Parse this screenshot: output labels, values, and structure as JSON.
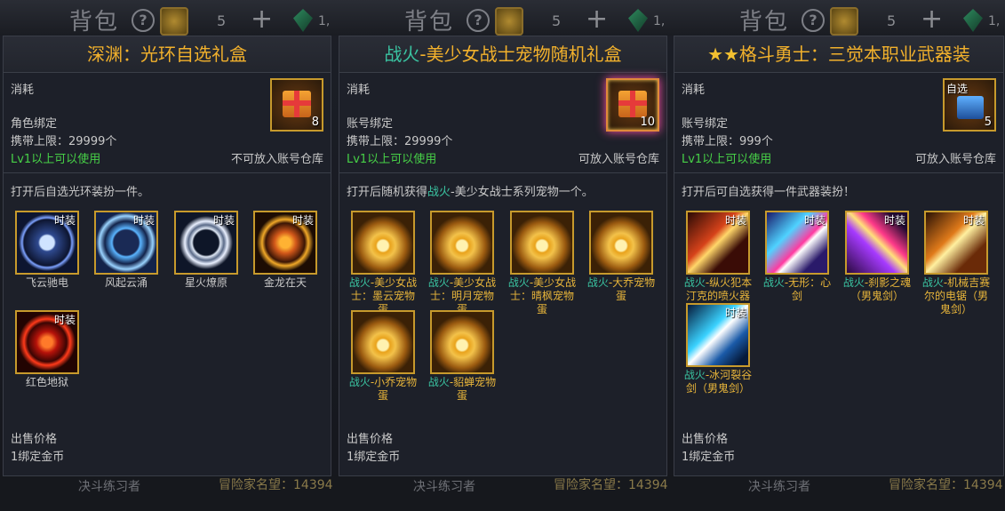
{
  "hud": {
    "title": "背包",
    "help": "?",
    "count": "5",
    "plus": "+",
    "gem_count": "1,",
    "player_name": "决斗练习者",
    "reputation": "冒险家名望：14394"
  },
  "panels": [
    {
      "title": "深渊：光环自选礼盒",
      "consume": "消耗",
      "bind": "角色绑定",
      "limit": "携带上限：29999个",
      "level": "Lv1以上可以使用",
      "storage": "不可放入账号仓库",
      "icon_count": "8",
      "desc": "打开后自选光环装扮一件。",
      "items": [
        {
          "name": "飞云驰电",
          "tag": "时装"
        },
        {
          "name": "风起云涌",
          "tag": "时装"
        },
        {
          "name": "星火燎原",
          "tag": "时装"
        },
        {
          "name": "金龙在天",
          "tag": "时装"
        },
        {
          "name": "红色地狱",
          "tag": "时装"
        }
      ],
      "sell_label": "出售价格",
      "sell_value": "1绑定金币"
    },
    {
      "title_prefix": "战火",
      "title_rest": "-美少女战士宠物随机礼盒",
      "consume": "消耗",
      "bind": "账号绑定",
      "limit": "携带上限：29999个",
      "level": "Lv1以上可以使用",
      "storage": "可放入账号仓库",
      "icon_count": "10",
      "desc_pre": "打开后随机获得",
      "desc_teal": "战火",
      "desc_post": "-美少女战士系列宠物一个。",
      "items": [
        {
          "prefix": "战火",
          "name": "-美少女战士：墨云宠物蛋"
        },
        {
          "prefix": "战火",
          "name": "-美少女战士：明月宠物蛋"
        },
        {
          "prefix": "战火",
          "name": "-美少女战士：晴枫宠物蛋"
        },
        {
          "prefix": "战火",
          "name": "-大乔宠物蛋"
        },
        {
          "prefix": "战火",
          "name": "-小乔宠物蛋"
        },
        {
          "prefix": "战火",
          "name": "-貂蝉宠物蛋"
        }
      ],
      "sell_label": "出售价格",
      "sell_value": "1绑定金币"
    },
    {
      "title_stars": "★★",
      "title": "格斗勇士：三觉本职业武器装",
      "consume": "消耗",
      "bind": "账号绑定",
      "limit": "携带上限：999个",
      "level": "Lv1以上可以使用",
      "storage": "可放入账号仓库",
      "icon_tag": "自选",
      "icon_count": "5",
      "desc": "打开后可自选获得一件武器装扮！",
      "items": [
        {
          "prefix": "战火",
          "name": "-纵火犯本汀克的喷火器（男鬼剑）",
          "tag": "时装"
        },
        {
          "prefix": "战火",
          "name": "-无形：心剑",
          "tag": "时装"
        },
        {
          "prefix": "战火",
          "name": "-刹影之魂（男鬼剑）",
          "tag": "时装"
        },
        {
          "prefix": "战火",
          "name": "-机械吉赛尔的电锯（男鬼剑）",
          "tag": "时装"
        },
        {
          "prefix": "战火",
          "name": "-冰河裂谷剑（男鬼剑）",
          "tag": "时装"
        }
      ],
      "sell_label": "出售价格",
      "sell_value": "1绑定金币"
    }
  ]
}
